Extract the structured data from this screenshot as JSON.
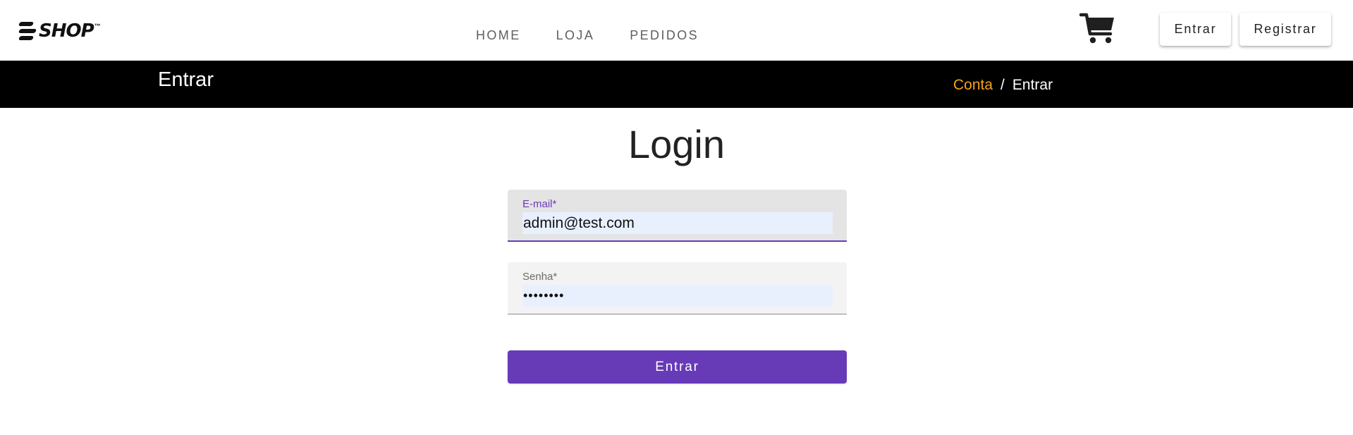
{
  "header": {
    "logo_text": "SHOP",
    "logo_tm": "™",
    "nav": [
      "HOME",
      "LOJA",
      "PEDIDOS"
    ],
    "cart_icon": "shopping-cart-icon",
    "login_label": "Entrar",
    "register_label": "Registrar"
  },
  "band": {
    "title": "Entrar",
    "breadcrumb": {
      "link": "Conta",
      "separator": "/",
      "current": "Entrar"
    }
  },
  "main": {
    "title": "Login",
    "email": {
      "label": "E-mail*",
      "value": "admin@test.com"
    },
    "password": {
      "label": "Senha*",
      "value": "••••••••"
    },
    "submit_label": "Entrar"
  },
  "colors": {
    "accent": "#673ab7",
    "breadcrumb_link": "#f7a21b",
    "band_bg": "#000000"
  }
}
